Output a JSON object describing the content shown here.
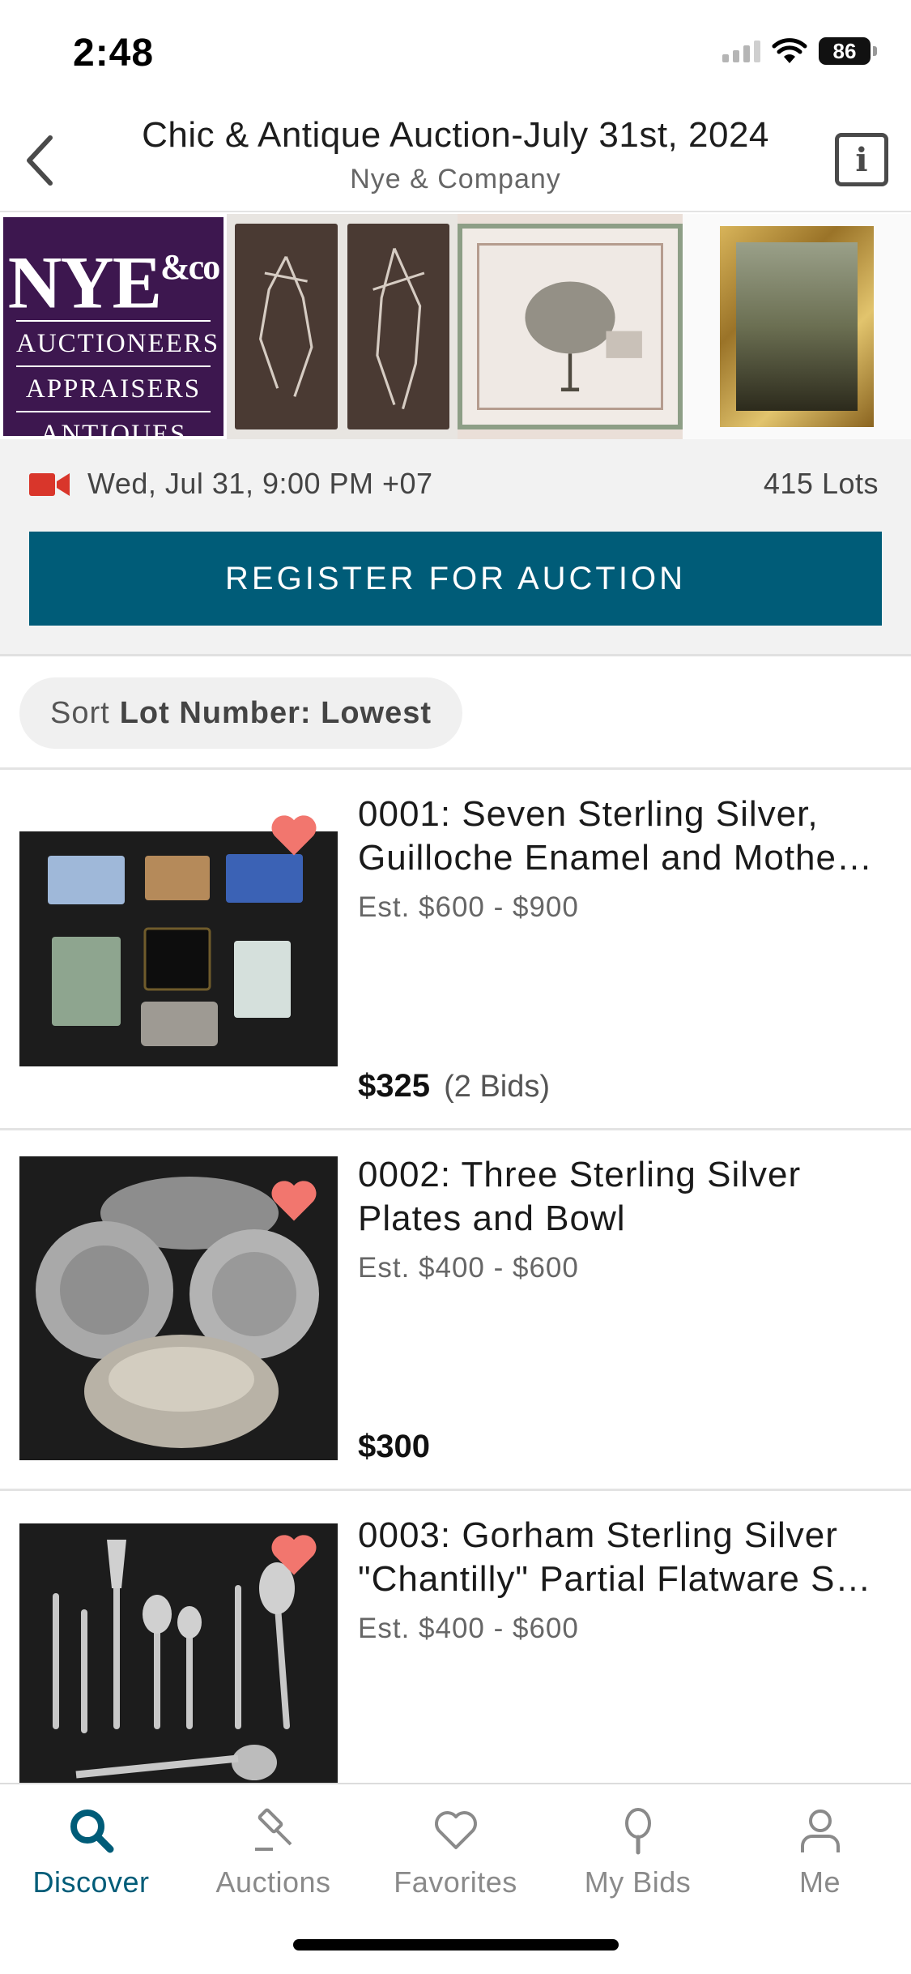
{
  "status_bar": {
    "time": "2:48",
    "battery": "86"
  },
  "header": {
    "title": "Chic & Antique Auction-July 31st, 2024",
    "subtitle": "Nye & Company"
  },
  "gallery": {
    "logo_main": "NYE",
    "logo_amp": "&co",
    "logo_lines": [
      "AUCTIONEERS",
      "APPRAISERS",
      "ANTIQUES"
    ]
  },
  "auction_info": {
    "date": "Wed, Jul 31, 9:00 PM +07",
    "lots": "415 Lots",
    "register_label": "REGISTER FOR AUCTION",
    "video_icon_color": "#d9362b"
  },
  "sort": {
    "prefix": "Sort",
    "value": "Lot Number: Lowest"
  },
  "lots": [
    {
      "title": "0001: Seven Sterling Silver, Guilloche Enamel and Mothe…",
      "estimate": "Est. $600 - $900",
      "price": "$325",
      "bids": "(2 Bids)",
      "favorited": true
    },
    {
      "title": "0002: Three Sterling Silver Plates and Bowl",
      "estimate": "Est. $400 - $600",
      "price": "$300",
      "bids": "",
      "favorited": true
    },
    {
      "title": "0003: Gorham Sterling Silver \"Chantilly\" Partial Flatware S…",
      "estimate": "Est. $400 - $600",
      "price": "",
      "bids": "",
      "favorited": true
    }
  ],
  "tabs": [
    {
      "label": "Discover",
      "icon": "search-icon",
      "active": true
    },
    {
      "label": "Auctions",
      "icon": "gavel-icon",
      "active": false
    },
    {
      "label": "Favorites",
      "icon": "heart-icon",
      "active": false
    },
    {
      "label": "My Bids",
      "icon": "paddle-icon",
      "active": false
    },
    {
      "label": "Me",
      "icon": "person-icon",
      "active": false
    }
  ],
  "colors": {
    "accent": "#005c78",
    "heart": "#f2766e",
    "inactive": "#8a8a8a"
  }
}
